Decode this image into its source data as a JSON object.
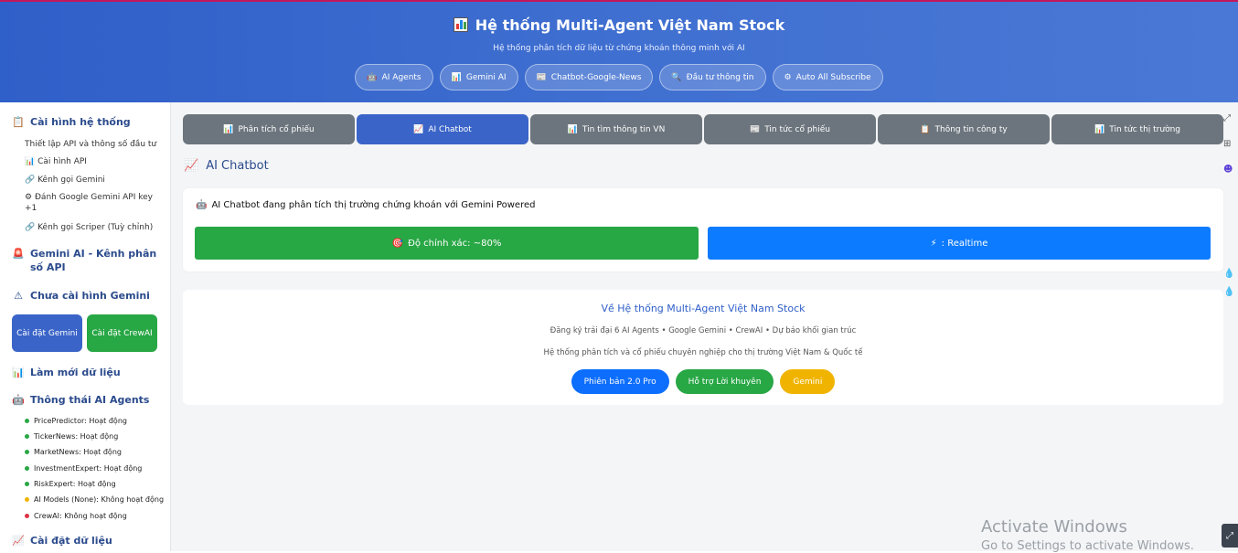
{
  "header": {
    "title": "Hệ thống Multi-Agent Việt Nam Stock",
    "subtitle": "Hệ thống phân tích dữ liệu từ chứng khoán thông minh với AI",
    "nav": [
      {
        "icon": "🤖",
        "label": "AI Agents"
      },
      {
        "icon": "📊",
        "label": "Gemini AI"
      },
      {
        "icon": "📰",
        "label": "Chatbot-Google-News"
      },
      {
        "icon": "🔍",
        "label": "Đầu tư thông tin"
      },
      {
        "icon": "⚙",
        "label": "Auto All Subscribe"
      }
    ]
  },
  "sidebar": {
    "config_title": "Cài hình hệ thống",
    "config_desc": "Thiết lập API và thông số đầu tư",
    "config_items": [
      {
        "icon": "📊",
        "label": "Cài hình API"
      },
      {
        "icon": "🔗",
        "label": "Kênh gọi Gemini"
      },
      {
        "icon": "⚙",
        "label": "Đánh Google Gemini API key +1"
      },
      {
        "icon": "🔗",
        "label": "Kênh gọi Scriper (Tuỳ chỉnh)"
      }
    ],
    "gemini_title": "Gemini AI - Kênh phân số API",
    "warning_title": "Chưa cài hình Gemini",
    "btn_gemini": "Cài đặt Gemini",
    "btn_crewai": "Cài đặt CrewAI",
    "refresh_title": "Làm mới dữ liệu",
    "agents_title": "Thông thái AI Agents",
    "agents": [
      {
        "label": "PricePredictor: Hoạt động",
        "color": "#28a745"
      },
      {
        "label": "TickerNews: Hoạt động",
        "color": "#28a745"
      },
      {
        "label": "MarketNews: Hoạt động",
        "color": "#28a745"
      },
      {
        "label": "InvestmentExpert: Hoạt động",
        "color": "#28a745"
      },
      {
        "label": "RiskExpert: Hoạt động",
        "color": "#28a745"
      },
      {
        "label": "AI Models (None): Không hoạt động",
        "color": "#f0b400"
      },
      {
        "label": "CrewAI: Không hoạt động",
        "color": "#dc3545"
      }
    ],
    "data_settings_title": "Cài đặt dữ liệu"
  },
  "tabs": [
    {
      "icon": "📊",
      "label": "Phân tích cổ phiếu",
      "active": false
    },
    {
      "icon": "📈",
      "label": "AI Chatbot",
      "active": true
    },
    {
      "icon": "📊",
      "label": "Tin tìm thông tin VN",
      "active": false
    },
    {
      "icon": "📰",
      "label": "Tin tức cổ phiếu",
      "active": false
    },
    {
      "icon": "📋",
      "label": "Thông tin công ty",
      "active": false
    },
    {
      "icon": "📊",
      "label": "Tin tức thị trường",
      "active": false
    }
  ],
  "main": {
    "section_title": "AI Chatbot",
    "status_text": "AI Chatbot đang phân tích thị trường chứng khoán với Gemini Powered",
    "metric_accuracy": "Độ chính xác: ~80%",
    "metric_realtime": ": Realtime",
    "about_title": "Về Hệ thống Multi-Agent Việt Nam Stock",
    "about_line1": "Đăng ký trải đại 6 AI Agents • Google Gemini • CrewAI • Dự báo khối gian trúc",
    "about_line2": "Hệ thống phân tích và cổ phiếu chuyên nghiệp cho thị trường Việt Nam & Quốc tế",
    "badges": [
      {
        "label": "Phiên bản 2.0 Pro",
        "color": "#0d6efd"
      },
      {
        "label": "Hỗ trợ Lời khuyên",
        "color": "#28a745"
      },
      {
        "label": "Gemini",
        "color": "#f0b400"
      }
    ]
  },
  "watermark": {
    "line1": "Activate Windows",
    "line2": "Go to Settings to activate Windows."
  },
  "colors": {
    "accent": "#3a64c8",
    "tab_inactive": "#6c757d",
    "green": "#28a745",
    "blue": "#0d7bff"
  }
}
